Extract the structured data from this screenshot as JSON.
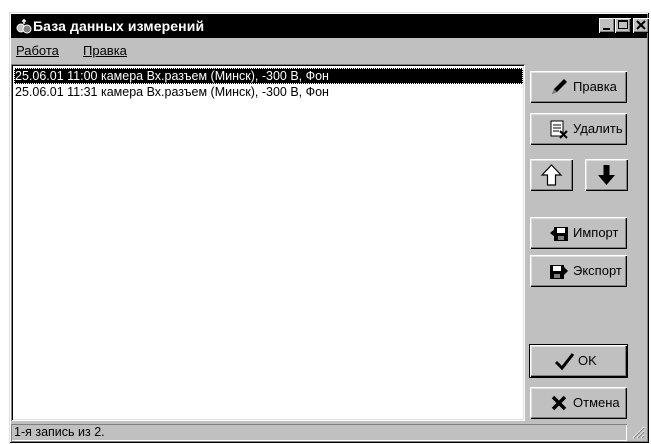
{
  "window": {
    "title": "База данных измерений",
    "icon": "database-app-icon"
  },
  "title_buttons": [
    "minimize-icon",
    "maximize-icon",
    "close-icon"
  ],
  "menu": {
    "items": [
      "Работа",
      "Правка"
    ]
  },
  "list": {
    "rows": [
      "25.06.01 11:00 камера Вх.разъем (Минск), -300 В, Фон",
      "25.06.01 11:31 камера Вх.разъем (Минск), -300 В, Фон"
    ],
    "selected_index": 0
  },
  "buttons": {
    "edit": {
      "label": "Правка",
      "icon": "pencil-icon"
    },
    "delete": {
      "label": "Удалить",
      "icon": "delete-document-icon"
    },
    "move_up": {
      "icon": "arrow-up-icon"
    },
    "move_down": {
      "icon": "arrow-down-icon"
    },
    "import": {
      "label": "Импорт",
      "icon": "floppy-import-icon"
    },
    "export": {
      "label": "Экспорт",
      "icon": "floppy-export-icon"
    },
    "ok": {
      "label": "OK",
      "icon": "checkmark-icon"
    },
    "cancel": {
      "label": "Отмена",
      "icon": "x-icon"
    }
  },
  "status": {
    "text": "1-я запись из 2."
  },
  "colors": {
    "face": "#c0c0c0",
    "title_bg": "#000000",
    "selection": "#000000"
  }
}
